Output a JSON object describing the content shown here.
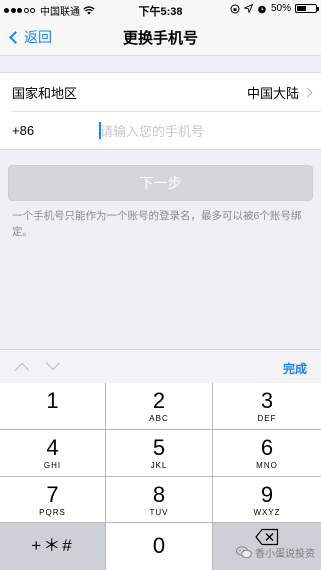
{
  "status_bar": {
    "carrier": "中国联通",
    "time": "下午5:38",
    "battery_percent": "50%",
    "battery_level": 0.5,
    "signal_filled": 3,
    "signal_total": 5
  },
  "nav": {
    "back_label": "返回",
    "title": "更换手机号"
  },
  "form": {
    "region_label": "国家和地区",
    "region_value": "中国大陆",
    "country_code": "+86",
    "phone_placeholder": "请输入您的手机号",
    "phone_value": ""
  },
  "next_button": "下一步",
  "hint": "一个手机号只能作为一个账号的登录名，最多可以被6个账号绑定。",
  "keyboard": {
    "done_label": "完成",
    "keys": [
      {
        "num": "1",
        "letters": ""
      },
      {
        "num": "2",
        "letters": "ABC"
      },
      {
        "num": "3",
        "letters": "DEF"
      },
      {
        "num": "4",
        "letters": "GHI"
      },
      {
        "num": "5",
        "letters": "JKL"
      },
      {
        "num": "6",
        "letters": "MNO"
      },
      {
        "num": "7",
        "letters": "PQRS"
      },
      {
        "num": "8",
        "letters": "TUV"
      },
      {
        "num": "9",
        "letters": "WXYZ"
      }
    ],
    "symbols_key": "+＊#",
    "zero_key": "0"
  },
  "watermark": "香小蛋说投资",
  "colors": {
    "accent": "#1a82f5",
    "background": "#efeff4",
    "disabled_button": "#d6d6d9"
  }
}
